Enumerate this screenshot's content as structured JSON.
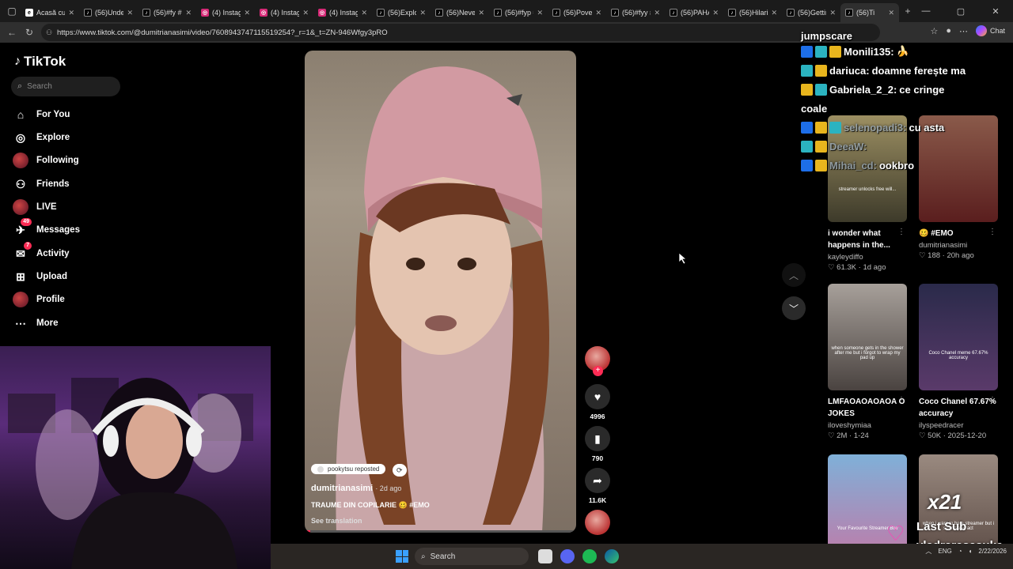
{
  "browser": {
    "tabs": [
      {
        "icon": "edge-tab-icon",
        "label": "Acasă cu",
        "type": "e",
        "active": false
      },
      {
        "icon": "tiktok-tab-icon",
        "label": "(56)Under",
        "type": "tk",
        "active": false
      },
      {
        "icon": "tiktok-tab-icon",
        "label": "(56)#fy #",
        "type": "tk",
        "active": false
      },
      {
        "icon": "instagram-tab-icon",
        "label": "(4) Instagr",
        "type": "ig",
        "active": false
      },
      {
        "icon": "instagram-tab-icon",
        "label": "(4) Instagr",
        "type": "ig",
        "active": false
      },
      {
        "icon": "instagram-tab-icon",
        "label": "(4) Instagr",
        "type": "ig",
        "active": false
      },
      {
        "icon": "tiktok-tab-icon",
        "label": "(56)Explor",
        "type": "tk",
        "active": false
      },
      {
        "icon": "tiktok-tab-icon",
        "label": "(56)Never",
        "type": "tk",
        "active": false
      },
      {
        "icon": "tiktok-tab-icon",
        "label": "(56)#fyp #",
        "type": "tk",
        "active": false
      },
      {
        "icon": "tiktok-tab-icon",
        "label": "(56)Povest",
        "type": "tk",
        "active": false
      },
      {
        "icon": "tiktok-tab-icon",
        "label": "(56)#fyy #",
        "type": "tk",
        "active": false
      },
      {
        "icon": "tiktok-tab-icon",
        "label": "(56)PAHAR",
        "type": "tk",
        "active": false
      },
      {
        "icon": "tiktok-tab-icon",
        "label": "(56)Hilario",
        "type": "tk",
        "active": false
      },
      {
        "icon": "tiktok-tab-icon",
        "label": "(56)Gettin",
        "type": "tk",
        "active": false
      },
      {
        "icon": "tiktok-tab-icon",
        "label": "(56)Ti",
        "type": "tk",
        "active": true
      }
    ],
    "url": "https://www.tiktok.com/@dumitrianasimi/video/7608943747115519254?_r=1&_t=ZN-946Wfgy3pRO",
    "chat_label": "Chat"
  },
  "sidebar": {
    "brand": "TikTok",
    "search_placeholder": "Search",
    "items": [
      {
        "label": "For You",
        "icon": "home-icon"
      },
      {
        "label": "Explore",
        "icon": "compass-icon"
      },
      {
        "label": "Following",
        "icon": "avatar-icon"
      },
      {
        "label": "Friends",
        "icon": "friends-icon"
      },
      {
        "label": "LIVE",
        "icon": "avatar-icon"
      },
      {
        "label": "Messages",
        "icon": "message-icon",
        "badge": "49"
      },
      {
        "label": "Activity",
        "icon": "activity-icon",
        "badge": "7"
      },
      {
        "label": "Upload",
        "icon": "upload-icon"
      },
      {
        "label": "Profile",
        "icon": "avatar-icon"
      },
      {
        "label": "More",
        "icon": "more-icon"
      }
    ]
  },
  "video": {
    "repost_label": "pookytsu reposted",
    "author": "dumitrianasimi",
    "posted": "· 2d ago",
    "description": "TRAUME DIN COPILARIE 🥴 #EMO",
    "translation_link": "See translation"
  },
  "actions": {
    "likes": "4996",
    "saves": "790",
    "shares": "11.6K"
  },
  "recommended": [
    {
      "title": "i wonder what happens in the...",
      "user": "kayleydiffo",
      "likes": "61.3K",
      "age": "1d ago",
      "overlay": "streamer unlocks free will..."
    },
    {
      "title": "🥴 #EMO",
      "user": "dumitrianasimi",
      "likes": "188",
      "age": "20h ago",
      "overlay": ""
    },
    {
      "title": "LMFAOAOAOAOA O JOKES",
      "user": "iloveshymiaa",
      "likes": "2M",
      "age": "1-24",
      "overlay": "when someone gets in the shower after me but i forgot to wrap my pad up"
    },
    {
      "title": "Coco Chanel 67.67% accuracy",
      "user": "ilyspeedracer",
      "likes": "50K",
      "age": "2025-12-20",
      "overlay": "Coco Chanel meme 67.67% accuracy"
    },
    {
      "title": "",
      "user": "",
      "likes": "",
      "age": "",
      "overlay": "Your Favourite Streamer Btw"
    },
    {
      "title": "",
      "user": "",
      "likes": "",
      "age": "",
      "overlay": "when i want to be a streamer but i sound and act"
    }
  ],
  "stream_chat": {
    "title": "jumpscare",
    "messages": [
      {
        "user": "Monili135:",
        "text": "🍌"
      },
      {
        "user": "dariuca:",
        "text": "doamne ferește ma"
      },
      {
        "user": "Gabriela_2_2:",
        "text": "ce cringe"
      },
      {
        "user": "coale",
        "text": ""
      },
      {
        "user": "selenopadi3:",
        "text": "cu asta"
      },
      {
        "user": "DeeaW:",
        "text": ""
      },
      {
        "user": "Mihai_cd:",
        "text": "ookbro"
      }
    ]
  },
  "sub_alert": {
    "multiplier": "x21",
    "label": "Last Sub",
    "user": "vladraresasuke"
  },
  "taskbar": {
    "search": "Search",
    "lang": "ENG",
    "date": "2/22/2026"
  },
  "colors": {
    "accent": "#fe2c55",
    "background": "#000000"
  }
}
